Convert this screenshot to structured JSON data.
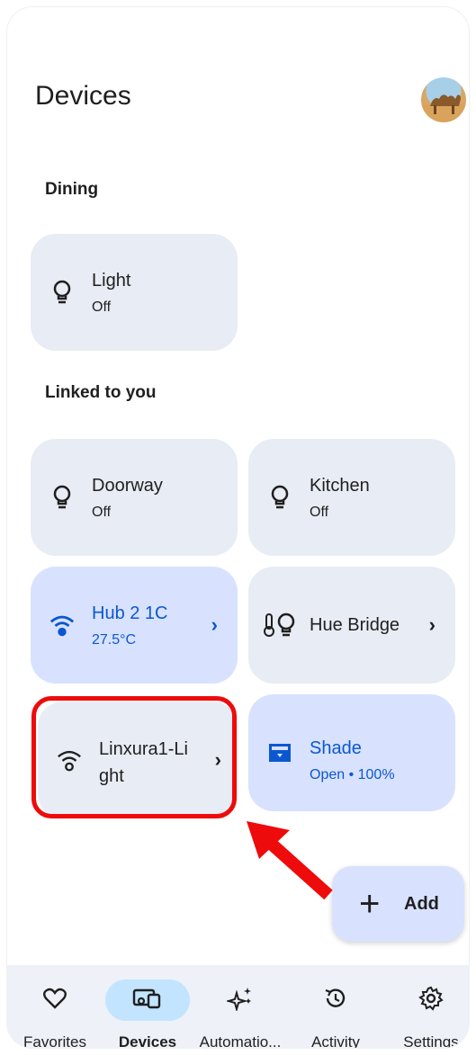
{
  "header": {
    "title": "Devices"
  },
  "sections": {
    "dining": "Dining",
    "linked": "Linked to you"
  },
  "devices": {
    "light": {
      "name": "Light",
      "status": "Off",
      "icon": "bulb-icon"
    },
    "doorway": {
      "name": "Doorway",
      "status": "Off",
      "icon": "bulb-icon"
    },
    "kitchen": {
      "name": "Kitchen",
      "status": "Off",
      "icon": "bulb-icon"
    },
    "hub": {
      "name": "Hub 2 1C",
      "status": "27.5°C",
      "icon": "wifi-icon"
    },
    "hue": {
      "name": "Hue Bridge",
      "icon": "thermo-bulb-icon"
    },
    "linxura": {
      "name_line1": "Linxura1-Li",
      "name_line2": "ght",
      "icon": "wifi-icon"
    },
    "shade": {
      "name": "Shade",
      "status": "Open • 100%",
      "icon": "shade-icon"
    }
  },
  "fab": {
    "label": "Add",
    "plus": "+"
  },
  "nav": {
    "items": [
      {
        "label": "Favorites",
        "icon": "heart-icon"
      },
      {
        "label": "Devices",
        "icon": "devices-icon",
        "active": true
      },
      {
        "label": "Automatio...",
        "icon": "sparkle-icon"
      },
      {
        "label": "Activity",
        "icon": "history-icon"
      },
      {
        "label": "Settings",
        "icon": "gear-icon"
      }
    ]
  },
  "colors": {
    "accent_blue": "#0b57d0",
    "tile": "#e8ecf4",
    "tile_active": "#d8e2ff",
    "highlight": "#ee0b0b"
  }
}
